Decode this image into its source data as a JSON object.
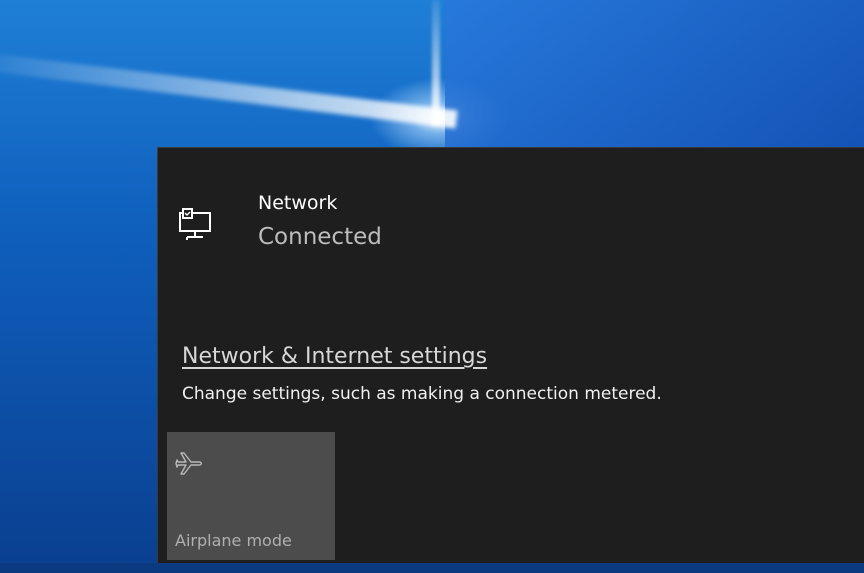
{
  "network": {
    "name": "Network",
    "status": "Connected",
    "icon": "wired-network-icon"
  },
  "settings": {
    "link_label": "Network & Internet settings",
    "description": "Change settings, such as making a connection metered."
  },
  "quick_actions": {
    "airplane_mode": {
      "label": "Airplane mode",
      "icon": "airplane-icon"
    }
  },
  "colors": {
    "flyout_bg": "#1e1e1e",
    "tile_bg": "#4c4c4c",
    "desktop_blue": "#0f5fbd"
  }
}
